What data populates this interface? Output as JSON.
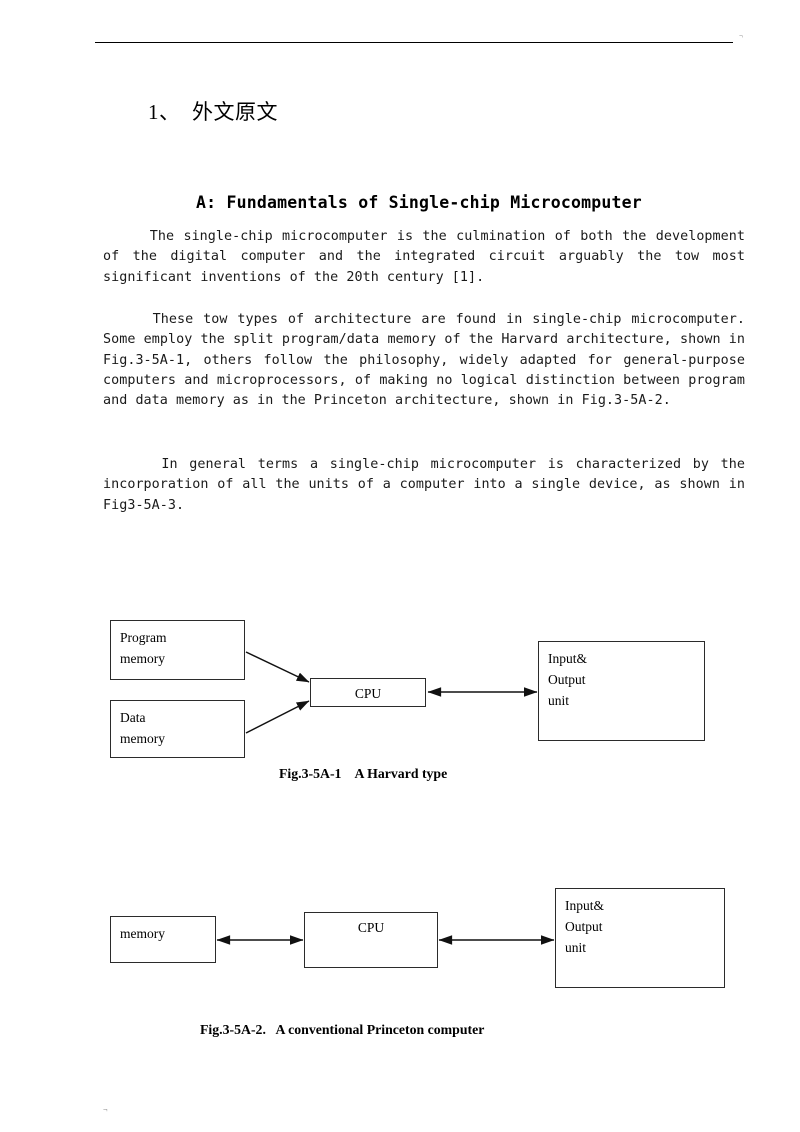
{
  "page": {
    "header_mark": "¬",
    "footer_mark": "¬"
  },
  "section": {
    "heading": "1、  外文原文"
  },
  "article": {
    "title": "A: Fundamentals of Single-chip Microcomputer",
    "paragraphs": [
      "     The single-chip microcomputer is the culmination of both the development of the digital computer and the integrated circuit arguably the tow most significant inventions of the 20th century [1].",
      "     These tow types of architecture are found in single-chip microcomputer. Some employ the split program/data memory of the Harvard architecture, shown in Fig.3-5A-1, others follow the philosophy, widely adapted for general-purpose computers and microprocessors, of making no logical distinction between program and data memory as in the Princeton architecture, shown in Fig.3-5A-2.",
      "     In general terms a single-chip microcomputer is characterized by the incorporation of all the units of a computer into a single device, as shown in Fig3-5A-3."
    ]
  },
  "figures": [
    {
      "id": "fig-3-5A-1",
      "caption": "Fig.3-5A-1    A Harvard type",
      "boxes": [
        {
          "name": "program-memory",
          "label": "Program\nmemory"
        },
        {
          "name": "data-memory",
          "label": "Data\nmemory"
        },
        {
          "name": "cpu",
          "label": "CPU"
        },
        {
          "name": "io-unit",
          "label": "Input&\nOutput\nunit"
        }
      ]
    },
    {
      "id": "fig-3-5A-2",
      "caption": "Fig.3-5A-2.   A conventional Princeton computer",
      "boxes": [
        {
          "name": "memory",
          "label": "memory"
        },
        {
          "name": "cpu",
          "label": "CPU"
        },
        {
          "name": "io-unit",
          "label": "Input&\nOutput\nunit"
        }
      ]
    }
  ],
  "colors": {
    "text": "#000000",
    "rule": "#000000",
    "box_border": "#2b2b2b",
    "background": "#ffffff"
  }
}
